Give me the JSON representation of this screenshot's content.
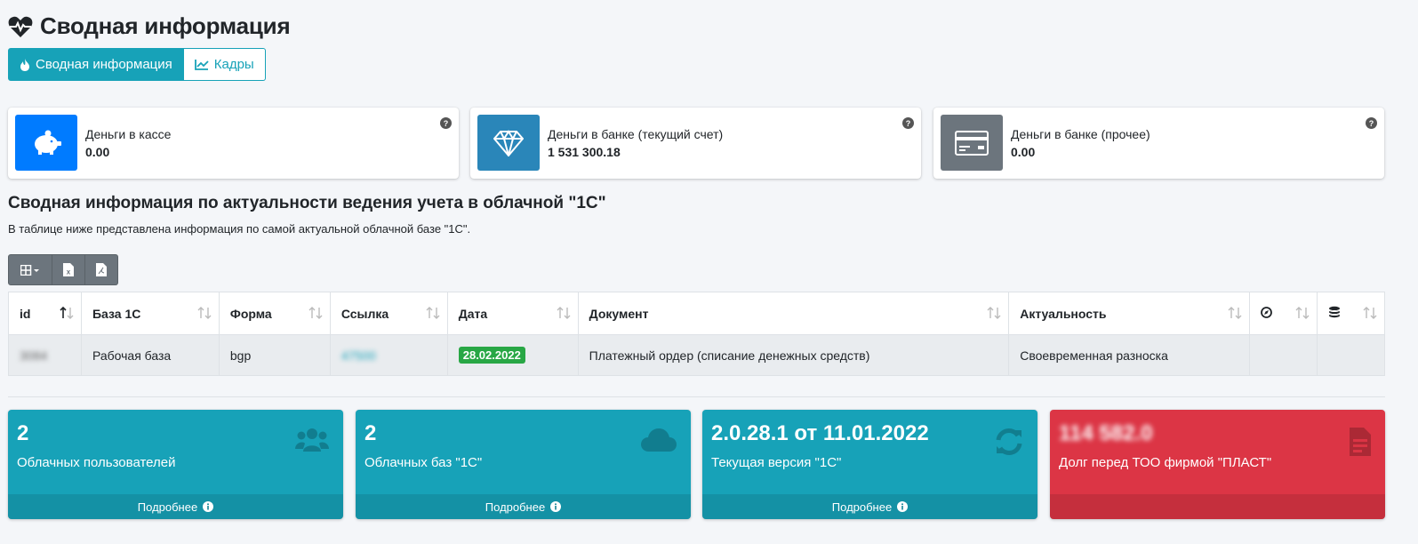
{
  "header": {
    "title": "Сводная информация"
  },
  "tabs": [
    {
      "label": "Сводная информация",
      "icon": "fire-icon",
      "active": true
    },
    {
      "label": "Кадры",
      "icon": "chart-line-icon",
      "active": false
    }
  ],
  "info_boxes": [
    {
      "label": "Деньги в кассе",
      "value": "0.00",
      "icon": "piggy-bank-icon",
      "color": "#007bff"
    },
    {
      "label": "Деньги в банке (текущий счет)",
      "value": "1 531 300.18",
      "icon": "gem-icon",
      "color": "#2a86b9"
    },
    {
      "label": "Деньги в банке (прочее)",
      "value": "0.00",
      "icon": "credit-card-icon",
      "color": "#6c757d"
    }
  ],
  "section": {
    "title": "Сводная информация по актуальности ведения учета в облачной \"1С\"",
    "description": "В таблице ниже представлена информация по самой актуальной облачной базе \"1С\"."
  },
  "table": {
    "columns": [
      "id",
      "База 1С",
      "Форма",
      "Ссылка",
      "Дата",
      "Документ",
      "Актуальность",
      "",
      ""
    ],
    "rows": [
      {
        "id": "3084",
        "base": "Рабочая база",
        "form": "bgp",
        "link": "47500",
        "date": "28.02.2022",
        "document": "Платежный ордер (списание денежных средств)",
        "actuality": "Своевременная разноска"
      }
    ]
  },
  "stat_boxes": [
    {
      "number": "2",
      "label": "Облачных пользователей",
      "footer": "Подробнее",
      "icon": "users-icon",
      "color": "#17a2b8"
    },
    {
      "number": "2",
      "label": "Облачных баз \"1С\"",
      "footer": "Подробнее",
      "icon": "cloud-icon",
      "color": "#17a2b8"
    },
    {
      "number": "2.0.28.1 от 11.01.2022",
      "label": "Текущая версия \"1С\"",
      "footer": "Подробнее",
      "icon": "sync-icon",
      "color": "#17a2b8"
    },
    {
      "number": "114 582.0",
      "label": "Долг перед ТОО фирмой \"ПЛАСТ\"",
      "footer": "",
      "icon": "invoice-icon",
      "color": "#dc3545"
    }
  ]
}
